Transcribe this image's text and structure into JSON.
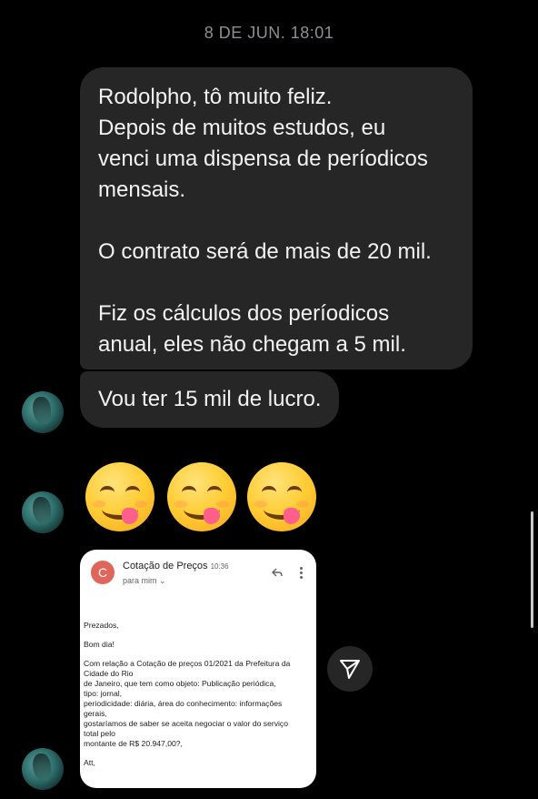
{
  "timestamp": "8 DE JUN. 18:01",
  "message_main": {
    "lines": [
      "Rodolpho, tô muito feliz.",
      "Depois de muitos estudos, eu\nvenci uma dispensa de períodicos\nmensais.",
      "O contrato será de mais de 20 mil.",
      "Fiz os cálculos dos períodicos\nanual, eles não chegam a 5 mil."
    ]
  },
  "message_second": "Vou ter 15 mil de lucro.",
  "emojis": [
    "yum-emoji",
    "yum-emoji",
    "yum-emoji"
  ],
  "email": {
    "avatar_letter": "C",
    "subject": "Cotação de Preços",
    "time": "10:36",
    "to": "para mim",
    "body": [
      "Prezados,",
      "Bom dia!",
      "Com relação a Cotação de preços 01/2021 da Prefeitura da\nCidade do Rio\nde Janeiro, que tem como objeto: Publicação periódica,\ntipo: jornal,\nperiodicidade: diária, área do conhecimento: informações\ngerais,\ngostaríamos de saber se aceita negociar o valor do serviço\ntotal pelo\nmontante de R$ 20.947,00?,",
      "Att,"
    ],
    "avatar_color": "#e0655a"
  },
  "icons": {
    "share": "share-icon",
    "reply": "reply-icon",
    "more": "more-vert-icon"
  }
}
